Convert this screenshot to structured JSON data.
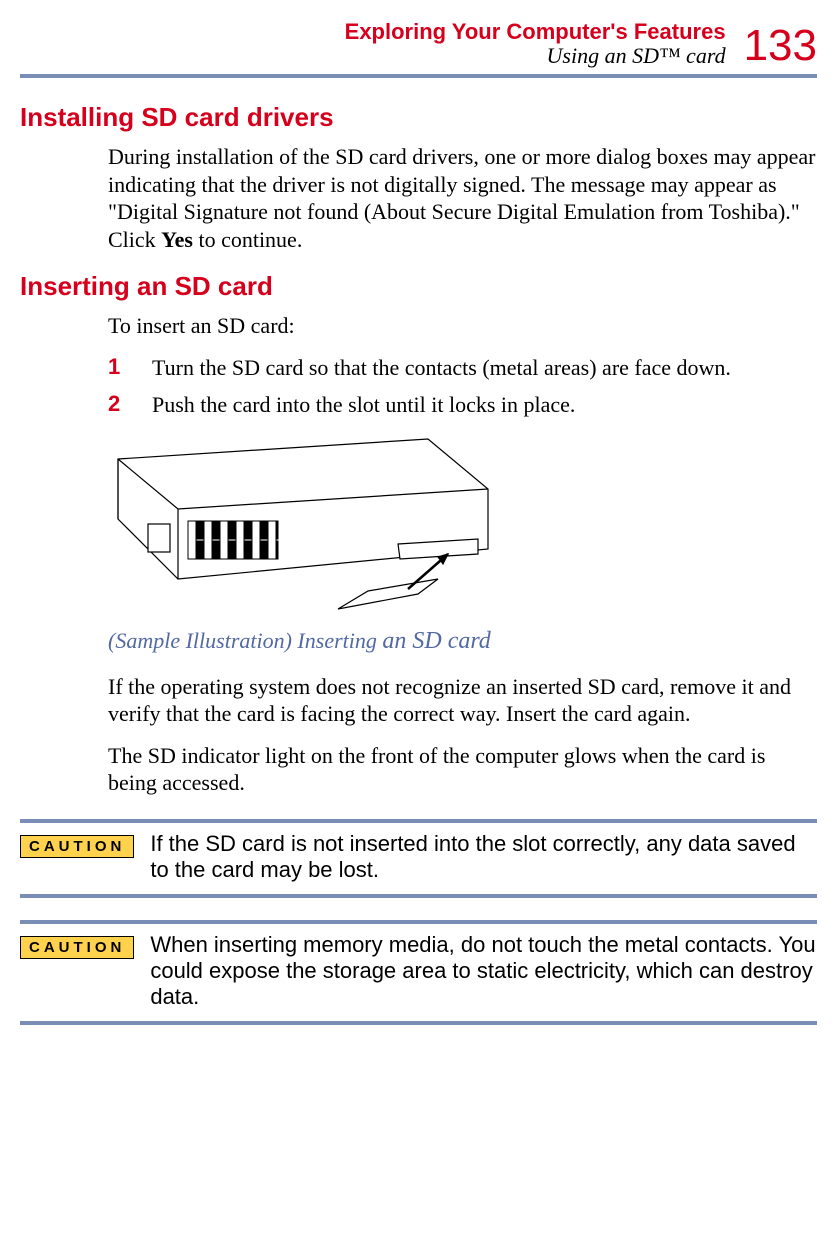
{
  "header": {
    "chapter": "Exploring Your Computer's Features",
    "section": "Using an SD™ card",
    "page_number": "133"
  },
  "section1": {
    "heading": "Installing SD card drivers",
    "para_before": "During installation of the SD card drivers, one or more dialog boxes may appear indicating that the driver is not digitally signed. The message may appear as \"Digital Signature not found (About Secure Digital Emulation from Toshiba).\" Click ",
    "para_bold": "Yes",
    "para_after": " to continue."
  },
  "section2": {
    "heading": "Inserting an SD card",
    "intro": "To insert an SD card:",
    "steps": [
      {
        "num": "1",
        "text": "Turn the SD card so that the contacts (metal areas) are face down."
      },
      {
        "num": "2",
        "text": "Push the card into the slot until it locks in place."
      }
    ],
    "caption_prefix": "(Sample Illustration) Inserting ",
    "caption_suffix": "an SD card",
    "para_after_illus": "If the operating system does not recognize an inserted SD card, remove it and verify that the card is facing the correct way. Insert the card again.",
    "para_indicator": "The SD indicator light on the front of the computer glows when the card is being accessed."
  },
  "cautions": [
    {
      "label": "CAUTION",
      "text": "If the SD card is not inserted into the slot correctly, any data saved to the card may be lost."
    },
    {
      "label": "CAUTION",
      "text": "When inserting memory media, do not touch the metal contacts. You could expose the storage area to static electricity, which can destroy data."
    }
  ]
}
